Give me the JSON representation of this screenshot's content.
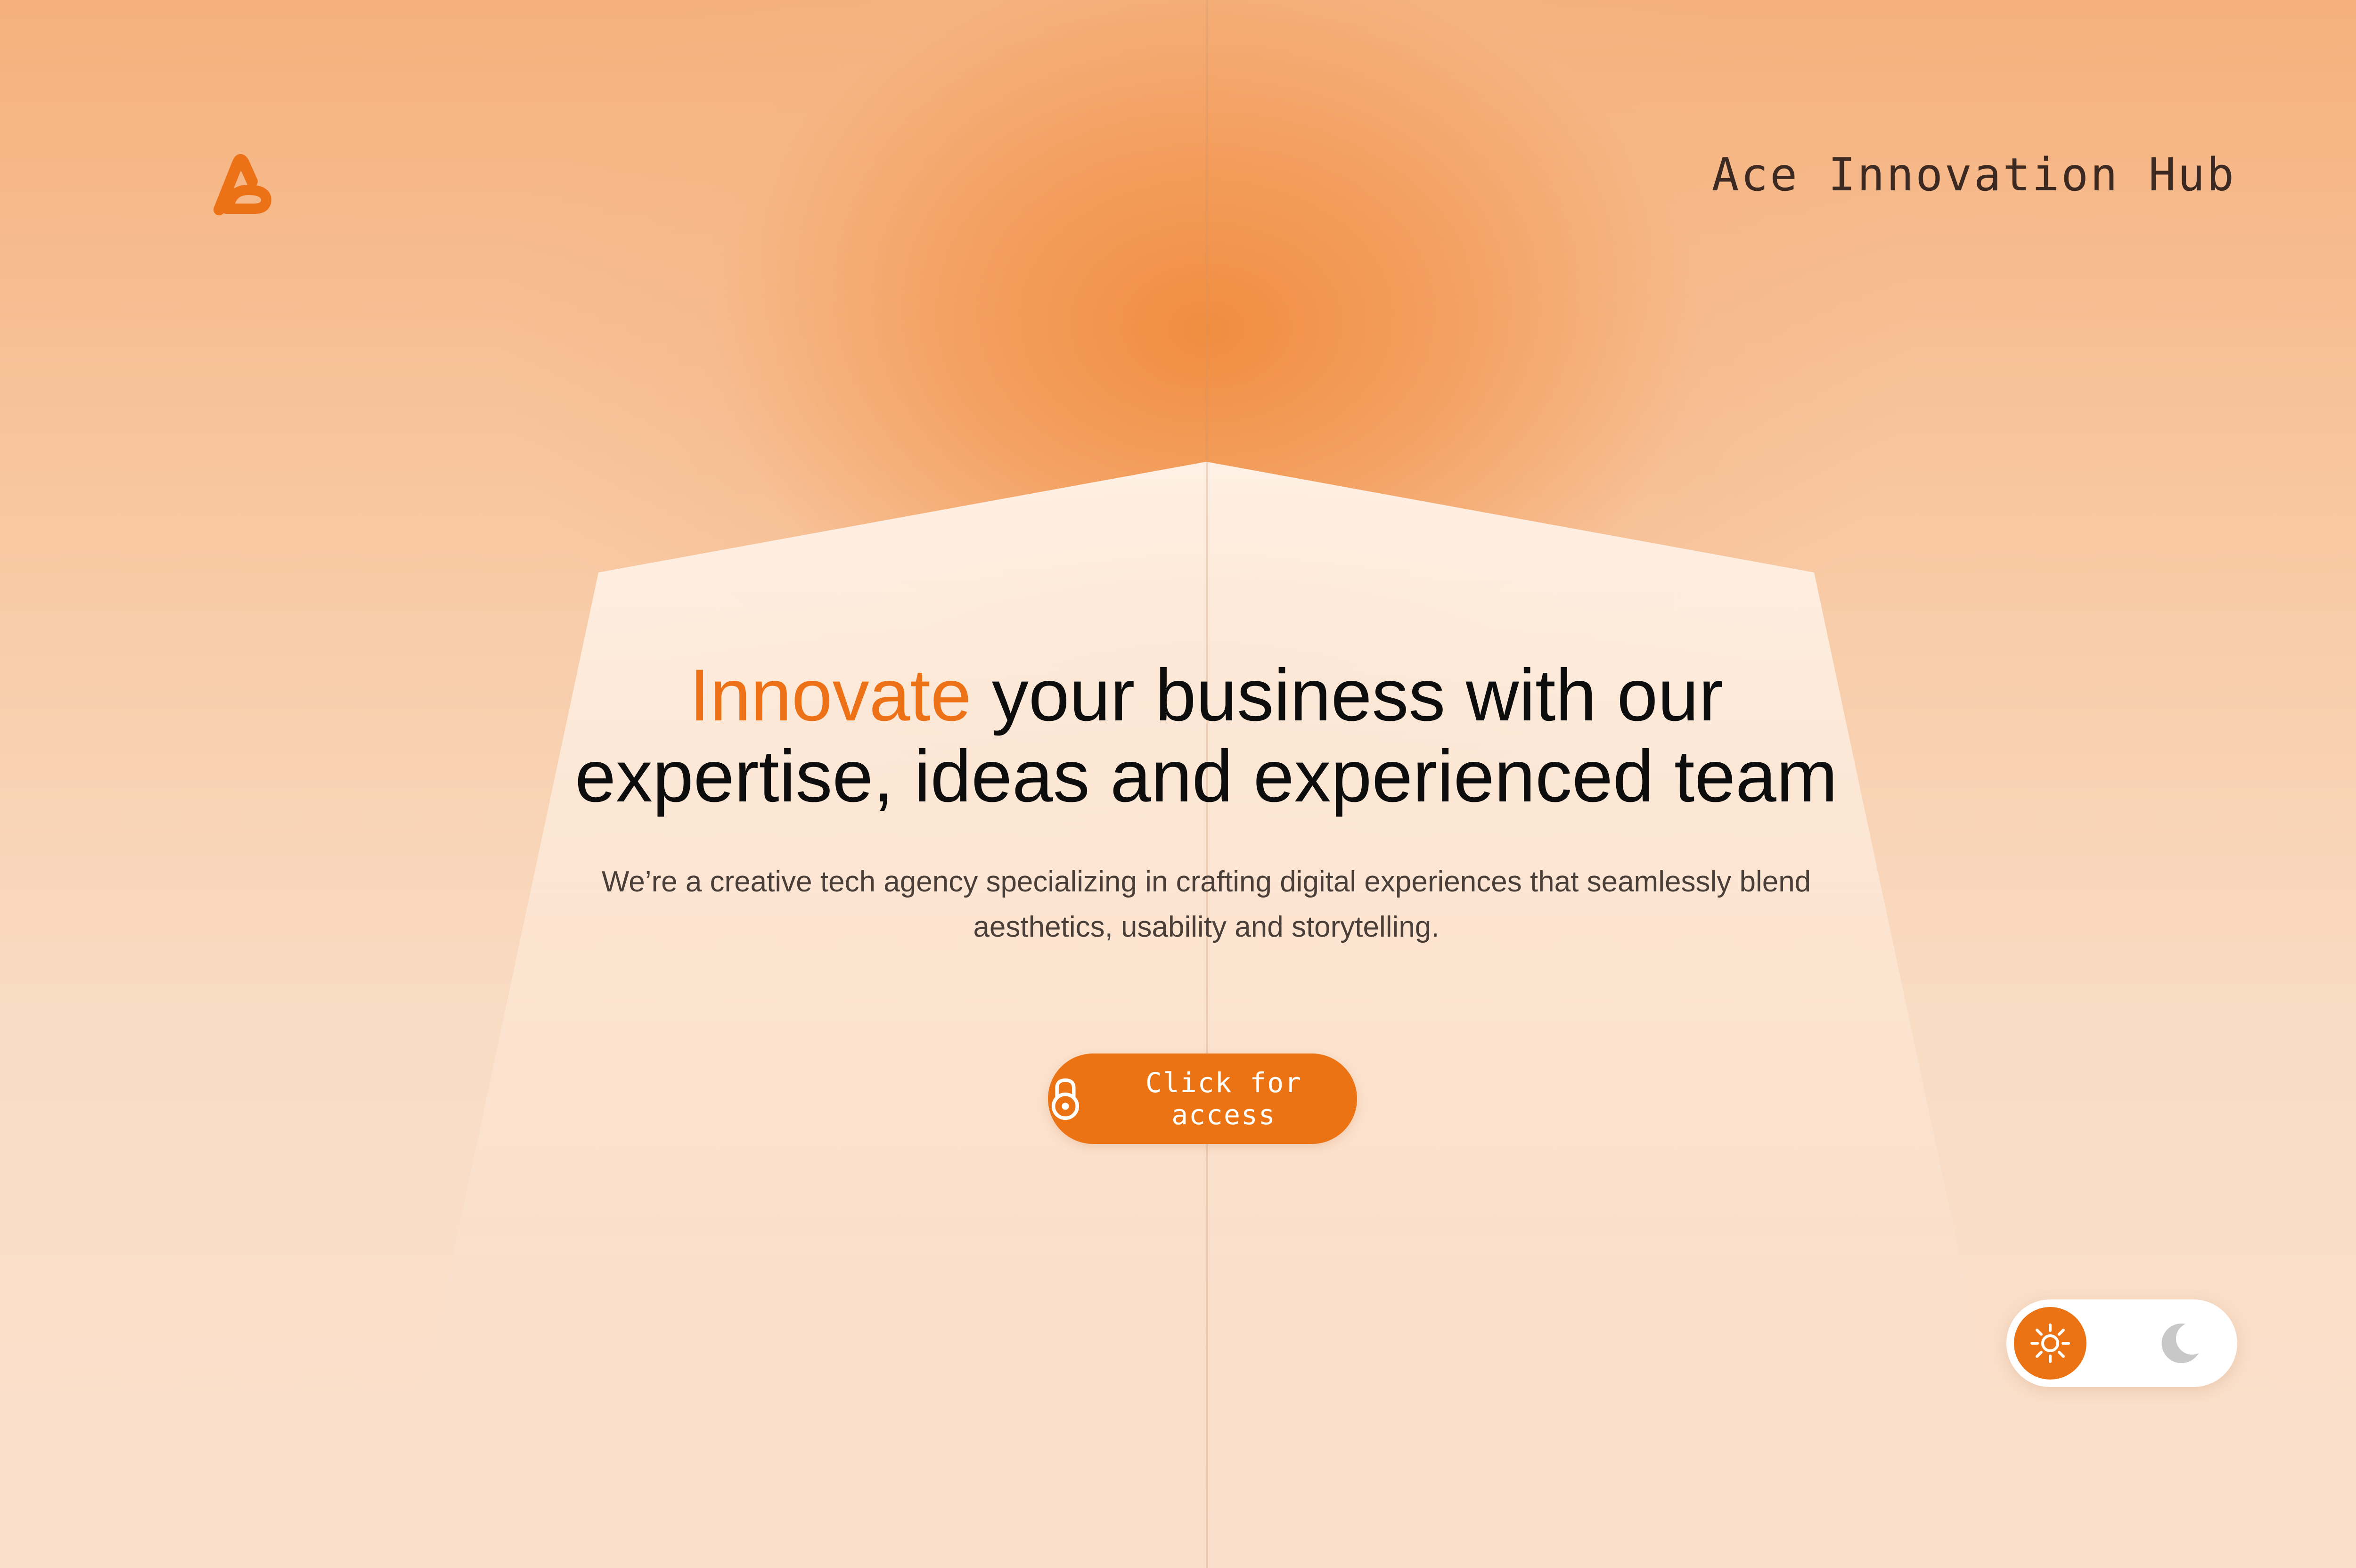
{
  "header": {
    "brand_name": "Ace Innovation Hub",
    "logo_icon": "ace-logo-icon"
  },
  "hero": {
    "headline_accent": "Innovate",
    "headline_line1_rest": " your business with our",
    "headline_line2": "expertise, ideas and experienced team",
    "subtext_line1": "We’re a creative tech agency specializing in crafting digital experiences that seamlessly blend",
    "subtext_line2": "aesthetics, usability and storytelling."
  },
  "cta": {
    "label": "Click for access",
    "icon": "lock-icon"
  },
  "theme_toggle": {
    "selected": "light",
    "light_icon": "sun-icon",
    "dark_icon": "moon-icon"
  },
  "colors": {
    "accent": "#ec7314",
    "background_warm": "#f8d8bd",
    "text_dark": "#0d0d0d"
  }
}
